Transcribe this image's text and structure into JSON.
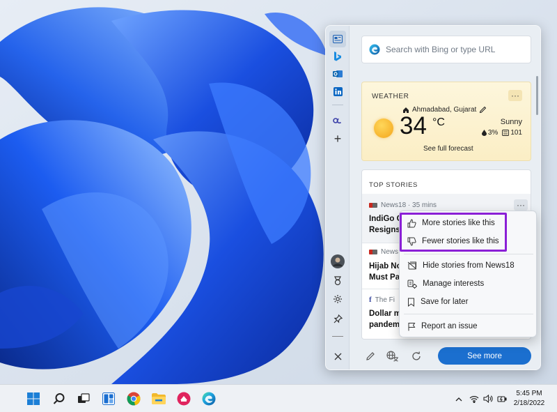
{
  "search": {
    "placeholder": "Search with Bing or type URL"
  },
  "weather": {
    "title": "WEATHER",
    "location": "Ahmadabad, Gujarat",
    "temperature": "34",
    "unit": "°C",
    "condition": "Sunny",
    "precipitation": "3%",
    "aqi": "101",
    "forecast_link": "See full forecast"
  },
  "stories": {
    "title": "TOP STORIES",
    "items": [
      {
        "source_meta": "News18 · 35 mins",
        "title_line1": "IndiGo C",
        "title_line2": "Resigns,"
      },
      {
        "source_meta": "News",
        "title_line1": "Hijab No",
        "title_line2": "Must Pas"
      },
      {
        "source_meta": "The Fi",
        "title_line1": "Dollar m",
        "title_line2": "pandemi"
      }
    ]
  },
  "context_menu": {
    "items": [
      {
        "label": "More stories like this",
        "icon": "thumbs-up-icon"
      },
      {
        "label": "Fewer stories like this",
        "icon": "thumbs-down-icon"
      },
      {
        "label": "Hide stories from News18",
        "icon": "hide-icon"
      },
      {
        "label": "Manage interests",
        "icon": "manage-interests-icon"
      },
      {
        "label": "Save for later",
        "icon": "bookmark-icon"
      },
      {
        "label": "Report an issue",
        "icon": "flag-icon"
      }
    ]
  },
  "bottom_bar": {
    "see_more_label": "See more"
  },
  "taskbar": {
    "apps": [
      "windows-start-icon",
      "search-icon",
      "task-view-icon",
      "widgets-icon",
      "chrome-icon",
      "file-explorer-icon",
      "app-icon",
      "edge-icon"
    ],
    "time": "5:45 PM",
    "date": "2/18/2022"
  },
  "colors": {
    "accent": "#1b6fcf",
    "highlight": "#8a1fd6",
    "weather_bg": "#fbeec5",
    "panel_bg": "#e9eef3"
  }
}
